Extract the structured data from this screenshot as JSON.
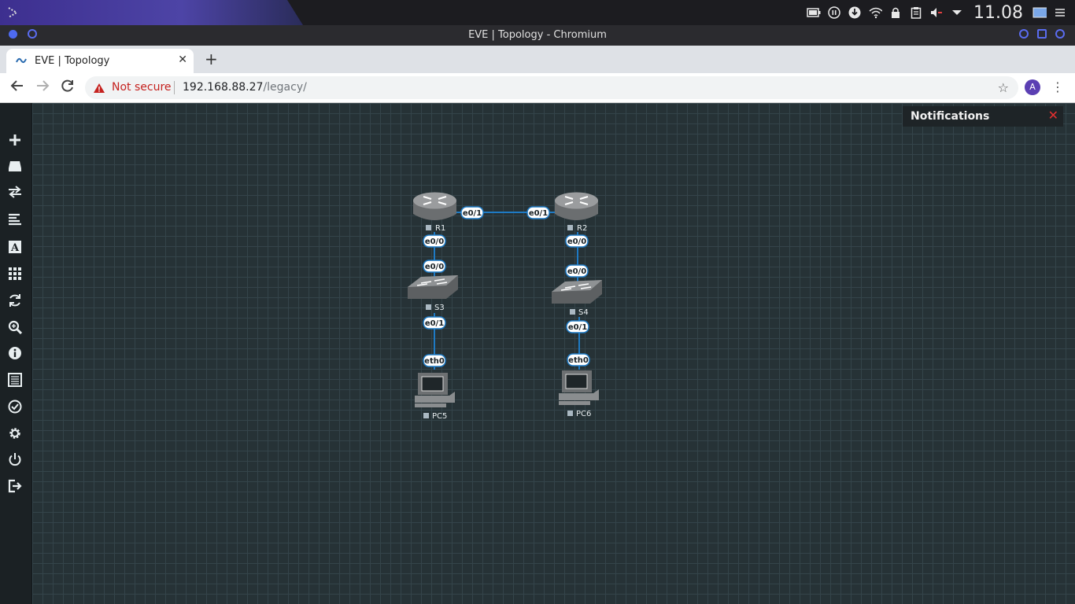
{
  "os_panel": {
    "clock": "11.08"
  },
  "browser": {
    "window_title": "EVE | Topology - Chromium",
    "tab_title": "EVE | Topology",
    "new_tab_symbol": "+",
    "security_text": "Not secure",
    "url_host": "192.168.88.27",
    "url_path": "/legacy/",
    "avatar_letter": "A"
  },
  "eve": {
    "sidebar_icons": [
      "add-icon",
      "storage-icon",
      "swap-icon",
      "align-icon",
      "text-icon",
      "grid-icon",
      "refresh-icon",
      "zoom-icon",
      "info-icon",
      "list-icon",
      "check-icon",
      "settings-icon",
      "power-icon",
      "logout-icon"
    ],
    "notifications_title": "Notifications",
    "nodes": [
      {
        "name": "R1",
        "type": "router"
      },
      {
        "name": "R2",
        "type": "router"
      },
      {
        "name": "S3",
        "type": "switch"
      },
      {
        "name": "S4",
        "type": "switch"
      },
      {
        "name": "PC5",
        "type": "pc"
      },
      {
        "name": "PC6",
        "type": "pc"
      }
    ],
    "links": [
      {
        "from": "R1",
        "from_if": "e0/1",
        "to": "R2",
        "to_if": "e0/1"
      },
      {
        "from": "R1",
        "from_if": "e0/0",
        "to": "S3",
        "to_if": "e0/0"
      },
      {
        "from": "R2",
        "from_if": "e0/0",
        "to": "S4",
        "to_if": "e0/0"
      },
      {
        "from": "S3",
        "from_if": "e0/1",
        "to": "PC5",
        "to_if": "eth0"
      },
      {
        "from": "S4",
        "from_if": "e0/1",
        "to": "PC6",
        "to_if": "eth0"
      }
    ],
    "colors": {
      "link": "#1e7ac4",
      "canvas": "#263236",
      "grid": "#34444a"
    }
  }
}
